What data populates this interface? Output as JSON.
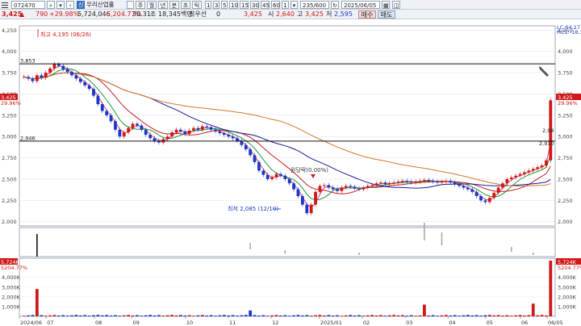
{
  "toolbar": {
    "code": "072470",
    "tag": "신",
    "name": "우리산업홀",
    "periods": [
      "주",
      "월",
      "년",
      "분",
      "초",
      "틱"
    ],
    "intervals": [
      "1",
      "3",
      "5",
      "10",
      "15",
      "30",
      "45",
      "60",
      "1"
    ],
    "count": "235/600",
    "date": "2025/06/05"
  },
  "quote": {
    "price": "3,425",
    "change": "790",
    "change_pct": "+29.98%",
    "volume": "5,724,046",
    "volume_ratio": "5,204.77%",
    "value": "30.31",
    "value_unit": "조",
    "shares": "18,345백만",
    "pref_label": "최우선",
    "pref_value": "0",
    "last": "3,425",
    "open_label": "시",
    "open": "2,640",
    "high_label": "고",
    "high": "3,425",
    "low_label": "저",
    "low": "2,595",
    "buy_label": "매수",
    "sell_label": "매도"
  },
  "chart_data": {
    "type": "candlestick",
    "y_ticks": [
      "4,250",
      "4,000",
      "3,750",
      "3,500",
      "3,250",
      "3,000",
      "2,750",
      "2,500",
      "2,250",
      "2,000"
    ],
    "y_range": [
      1950,
      4300
    ],
    "x_labels": [
      "2024/06",
      "07",
      "08",
      "09",
      "10",
      "11",
      "12",
      "2025/01",
      "02",
      "03",
      "04",
      "05",
      "06",
      "06/05"
    ],
    "h_lines": [
      {
        "value": 3853,
        "label": "3,853"
      },
      {
        "value": 2946,
        "label": "2,946"
      }
    ],
    "annotations": {
      "high": "최고 4,195 (06/26)",
      "low": "최저 2,085 (12/10)",
      "event": "원당락(0.00%)"
    },
    "right_labels": {
      "lc": "LC:64.27",
      "hc": "HC1:-18.36",
      "price": "3,425",
      "pct": "29.96%",
      "ma1": "2,98",
      "ma2": "2,910"
    },
    "close": [
      3700,
      3680,
      3650,
      3720,
      3690,
      3750,
      3800,
      3850,
      3830,
      3790,
      3760,
      3720,
      3680,
      3640,
      3600,
      3560,
      3480,
      3380,
      3300,
      3250,
      3180,
      3080,
      3000,
      3050,
      3100,
      3150,
      3130,
      3080,
      3020,
      2980,
      2950,
      2930,
      2970,
      3000,
      3050,
      3080,
      3060,
      3030,
      3070,
      3100,
      3080,
      3120,
      3110,
      3080,
      3060,
      3040,
      3020,
      3000,
      2980,
      2950,
      2900,
      2850,
      2780,
      2700,
      2600,
      2550,
      2500,
      2520,
      2560,
      2540,
      2500,
      2450,
      2380,
      2300,
      2200,
      2100,
      2200,
      2350,
      2420,
      2430,
      2400,
      2380,
      2360,
      2400,
      2420,
      2410,
      2390,
      2380,
      2400,
      2420,
      2430,
      2450,
      2460,
      2440,
      2450,
      2460,
      2470,
      2480,
      2470,
      2460,
      2470,
      2480,
      2490,
      2480,
      2470,
      2460,
      2470,
      2480,
      2460,
      2440,
      2420,
      2400,
      2380,
      2350,
      2300,
      2250,
      2230,
      2280,
      2340,
      2400,
      2450,
      2500,
      2520,
      2540,
      2560,
      2580,
      2600,
      2620,
      2640,
      2660,
      2720,
      3425
    ],
    "volume_ticks": [
      "4,000K",
      "3,000K",
      "2,000K",
      "1,000K"
    ],
    "volume_labels": {
      "last": "5,724K",
      "pct": "5204.77%"
    }
  }
}
